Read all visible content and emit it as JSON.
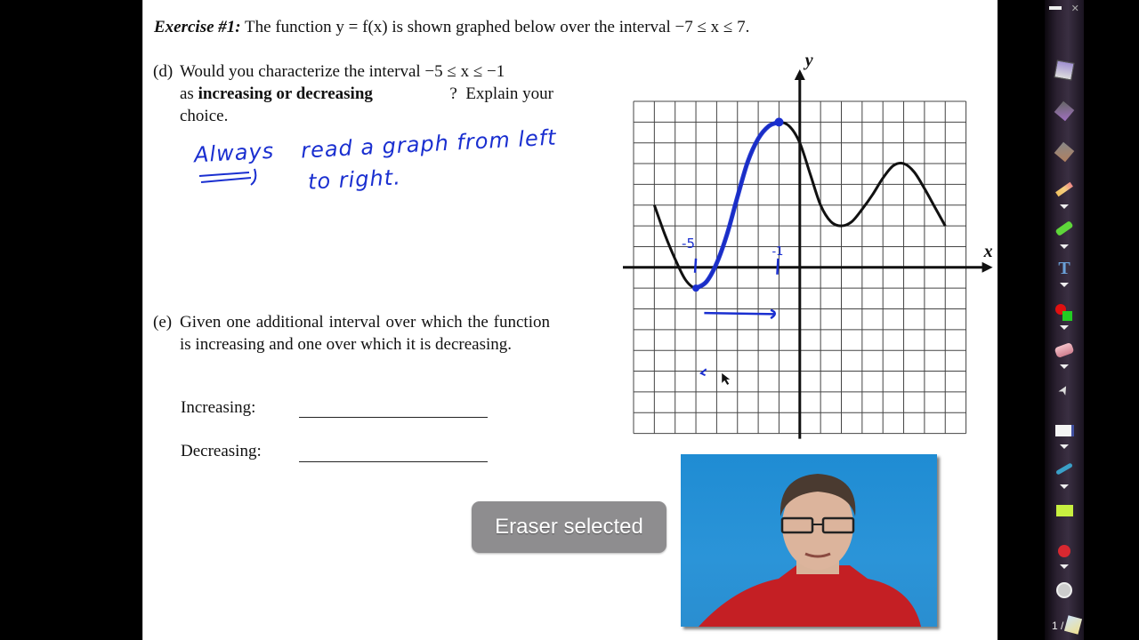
{
  "worksheet": {
    "title_label": "Exercise #1:",
    "title_text": "The function y = f(x) is shown graphed below over the interval −7 ≤ x ≤ 7.",
    "part_d": {
      "label": "(d)",
      "line1": "Would you characterize the interval −5 ≤ x ≤ −1",
      "line2_pre": "as ",
      "line2_bold": "increasing or decreasing",
      "line2_post": "?  Explain your",
      "line3": "choice."
    },
    "part_e": {
      "label": "(e)",
      "text": "Given one additional interval over which the function is increasing and one over which it is decreasing.",
      "increasing_label": "Increasing:",
      "decreasing_label": "Decreasing:",
      "increasing_value": "",
      "decreasing_value": ""
    },
    "handwriting": {
      "word1": "Always",
      "line1": "read a graph from left",
      "line2": "to right.",
      "graph_label_a": "-5",
      "graph_label_b": "-1",
      "color": "#1a2fd0"
    }
  },
  "chart_data": {
    "type": "line",
    "title": "",
    "xlabel": "x",
    "ylabel": "y",
    "xlim": [
      -8,
      8
    ],
    "ylim": [
      -8,
      8
    ],
    "grid": true,
    "series": [
      {
        "name": "f(x)",
        "x": [
          -7,
          -6.5,
          -6,
          -5.5,
          -5,
          -4.5,
          -4,
          -3.5,
          -3,
          -2.5,
          -2,
          -1.5,
          -1,
          -0.5,
          0,
          0.5,
          1,
          1.5,
          2,
          2.5,
          3,
          3.5,
          4,
          4.5,
          5,
          5.5,
          6,
          6.5,
          7
        ],
        "y": [
          3,
          1.6,
          0.4,
          -0.6,
          -1,
          -0.7,
          0.2,
          1.6,
          3.4,
          5.1,
          6.2,
          6.8,
          7,
          6.8,
          6,
          4.5,
          3,
          2.2,
          2,
          2.2,
          2.8,
          3.5,
          4.3,
          4.9,
          5,
          4.6,
          3.8,
          2.9,
          2
        ]
      },
      {
        "name": "highlighted interval [-5, -1]",
        "x": [
          -5,
          -4.5,
          -4,
          -3.5,
          -3,
          -2.5,
          -2,
          -1.5,
          -1
        ],
        "y": [
          -1,
          -0.7,
          0.2,
          1.6,
          3.4,
          5.1,
          6.2,
          6.8,
          7
        ]
      }
    ],
    "annotations": [
      "-5",
      "-1",
      "→ arrow left to right"
    ]
  },
  "toolbar": {
    "tools": [
      {
        "name": "minimize",
        "glyph": "▬"
      },
      {
        "name": "close",
        "glyph": "✕"
      },
      {
        "name": "save",
        "glyph": "💾"
      },
      {
        "name": "page-previous",
        "glyph": "◆"
      },
      {
        "name": "page-next",
        "glyph": "◆"
      },
      {
        "name": "pencil",
        "glyph": "✎"
      },
      {
        "name": "highlighter",
        "glyph": "▰"
      },
      {
        "name": "text",
        "glyph": "T"
      },
      {
        "name": "color",
        "glyph": "●"
      },
      {
        "name": "eraser",
        "glyph": "▭"
      },
      {
        "name": "pointer",
        "glyph": "➤"
      },
      {
        "name": "background",
        "glyph": "▭"
      },
      {
        "name": "shape",
        "glyph": "⟋"
      },
      {
        "name": "fill-rect",
        "glyph": "■"
      },
      {
        "name": "record",
        "glyph": "●"
      },
      {
        "name": "webcam",
        "glyph": "◉"
      }
    ],
    "page_indicator": "1 /"
  },
  "toast": {
    "text": "Eraser selected"
  }
}
